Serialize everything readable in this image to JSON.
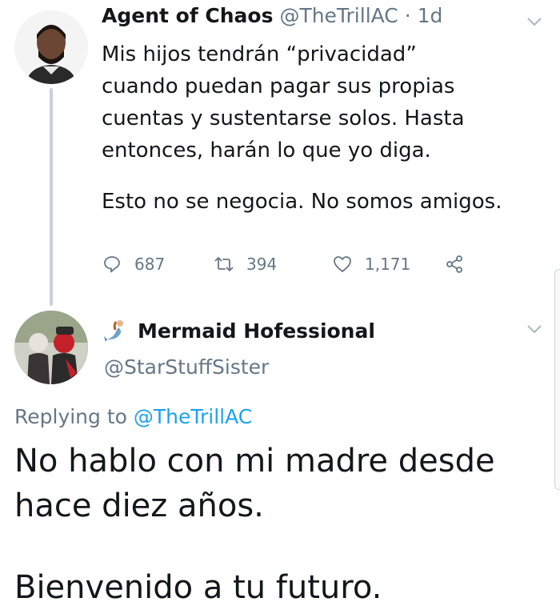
{
  "tweet": {
    "author_name": "Agent of Chaos",
    "author_handle": "@TheTrillAC",
    "separator": " · ",
    "time": "1d",
    "body_lines": [
      "Mis hijos tendrán “privacidad”",
      "cuando puedan pagar sus propias",
      "cuentas y sustentarse solos. Hasta",
      "entonces, harán lo que yo diga."
    ],
    "body_para2": "Esto no se negocia. No somos amigos.",
    "replies": "687",
    "retweets": "394",
    "likes": "1,171"
  },
  "reply": {
    "author_name": "Mermaid Hofessional",
    "author_handle": "@StarStuffSister",
    "replying_prefix": "Replying to ",
    "replying_to": "@TheTrillAC",
    "lines": [
      "No hablo con mi madre desde",
      "hace diez años.",
      "Bienvenido a tu futuro."
    ]
  },
  "icons": {
    "chevron": "chevron-down-icon",
    "reply": "reply-icon",
    "retweet": "retweet-icon",
    "like": "heart-icon",
    "share": "share-icon",
    "name_emoji": "mermaid-icon"
  },
  "colors": {
    "text": "#14171a",
    "secondary": "#657786",
    "link": "#1da1f2",
    "thread_line": "#c9d2da"
  }
}
